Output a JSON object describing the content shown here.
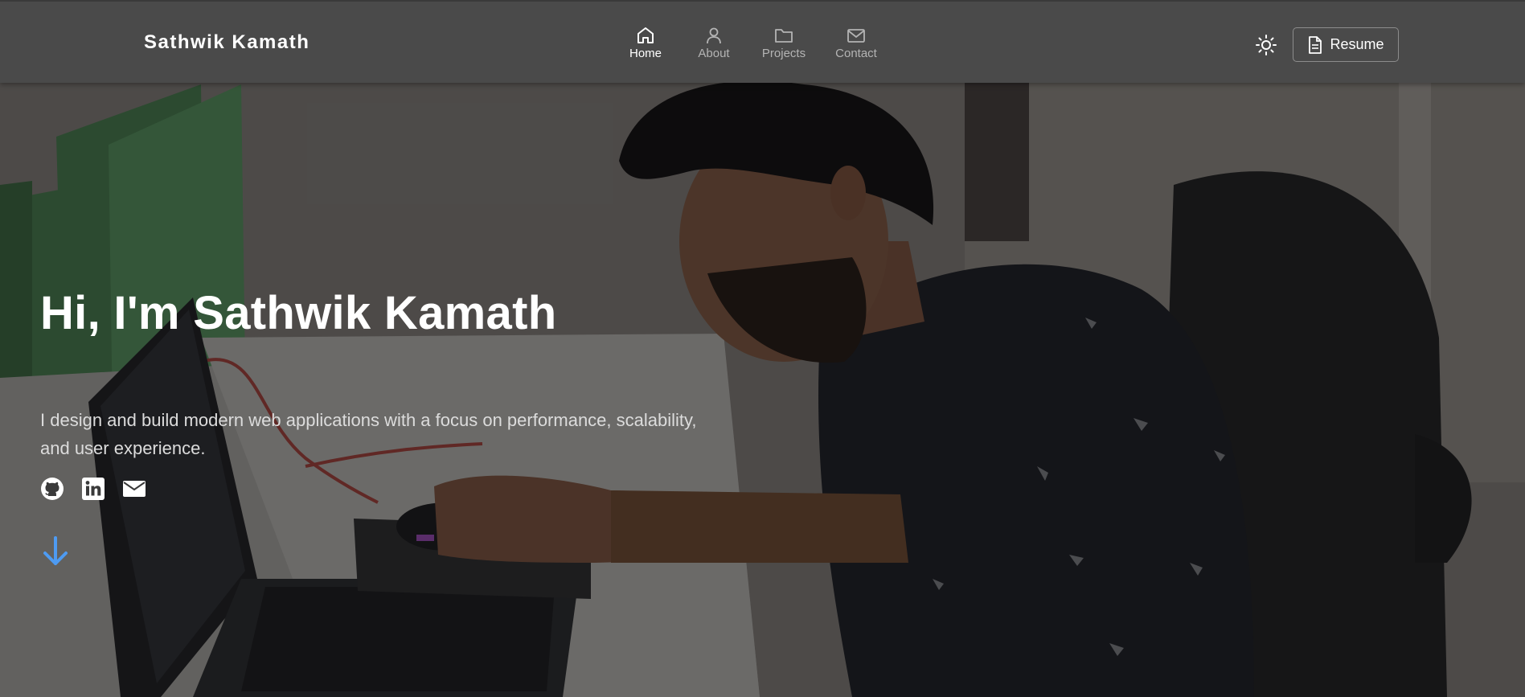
{
  "brand": {
    "name": "Sathwik Kamath"
  },
  "nav": {
    "items": [
      {
        "label": "Home",
        "icon": "home-icon",
        "active": true
      },
      {
        "label": "About",
        "icon": "user-icon",
        "active": false
      },
      {
        "label": "Projects",
        "icon": "folder-icon",
        "active": false
      },
      {
        "label": "Contact",
        "icon": "mail-icon",
        "active": false
      }
    ]
  },
  "header": {
    "theme_toggle_icon": "sun-icon",
    "resume_label": "Resume",
    "resume_icon": "document-icon"
  },
  "hero": {
    "title": "Hi, I'm Sathwik Kamath",
    "description": "I design and build modern web applications with a focus on performance, scalability, and user experience.",
    "socials": [
      "github-icon",
      "linkedin-icon",
      "email-icon"
    ],
    "scroll_icon": "arrow-down-icon",
    "background": "photo of a person working at a laptop"
  },
  "colors": {
    "navbar_bg": "#4a4a4a",
    "nav_active": "#ffffff",
    "nav_inactive": "#b4b4b4",
    "accent_arrow": "#4e9bf2"
  }
}
